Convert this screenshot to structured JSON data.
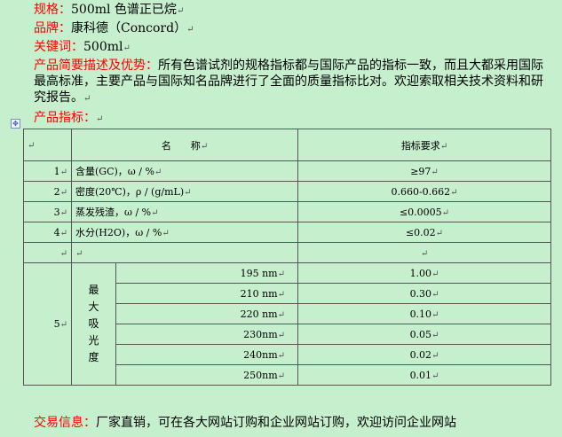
{
  "header": {
    "spec_label": "规格：",
    "spec_value": "500ml 色谱正已烷",
    "brand_label": "品牌：",
    "brand_value": "康科德（Concord）",
    "keyword_label": "关键词：",
    "keyword_value": "500ml",
    "desc_label": "产品简要描述及优势：",
    "desc_value": "所有色谱试剂的规格指标都与国际产品的指标一致，而且大都采用国际最高标准，主要产品与国际知名品牌进行了全面的质量指标比对。欢迎索取相关技术资料和研究报告。",
    "spec_table_label": "产品指标："
  },
  "paragraph_mark": "↵",
  "anchor_icon": "✥",
  "table": {
    "header": {
      "name": "名　　称",
      "requirement": "指标要求"
    },
    "rows": [
      {
        "num": "1",
        "name": "含量(GC)，ω / %",
        "value": "≥97"
      },
      {
        "num": "2",
        "name": "密度(20℃)，ρ / (g/mL)",
        "value": "0.660-0.662"
      },
      {
        "num": "3",
        "name": "蒸发残渣，ω / %",
        "value": "≤0.0005"
      },
      {
        "num": "4",
        "name": "水分(H2O)，ω / %",
        "value": "≤0.02"
      }
    ],
    "absorbance": {
      "num": "5",
      "label": [
        "最",
        "大",
        "吸",
        "光",
        "度"
      ],
      "rows": [
        {
          "wavelength": "195 nm",
          "value": "1.00"
        },
        {
          "wavelength": "210 nm",
          "value": "0.30"
        },
        {
          "wavelength": "220 nm",
          "value": "0.10"
        },
        {
          "wavelength": "230nm",
          "value": "0.05"
        },
        {
          "wavelength": "240nm",
          "value": "0.02"
        },
        {
          "wavelength": "250nm",
          "value": "0.01"
        }
      ]
    }
  },
  "footer": {
    "label": "交易信息：",
    "value": "厂家直销，可在各大网站订购和企业网站订购，欢迎访问企业网站"
  }
}
